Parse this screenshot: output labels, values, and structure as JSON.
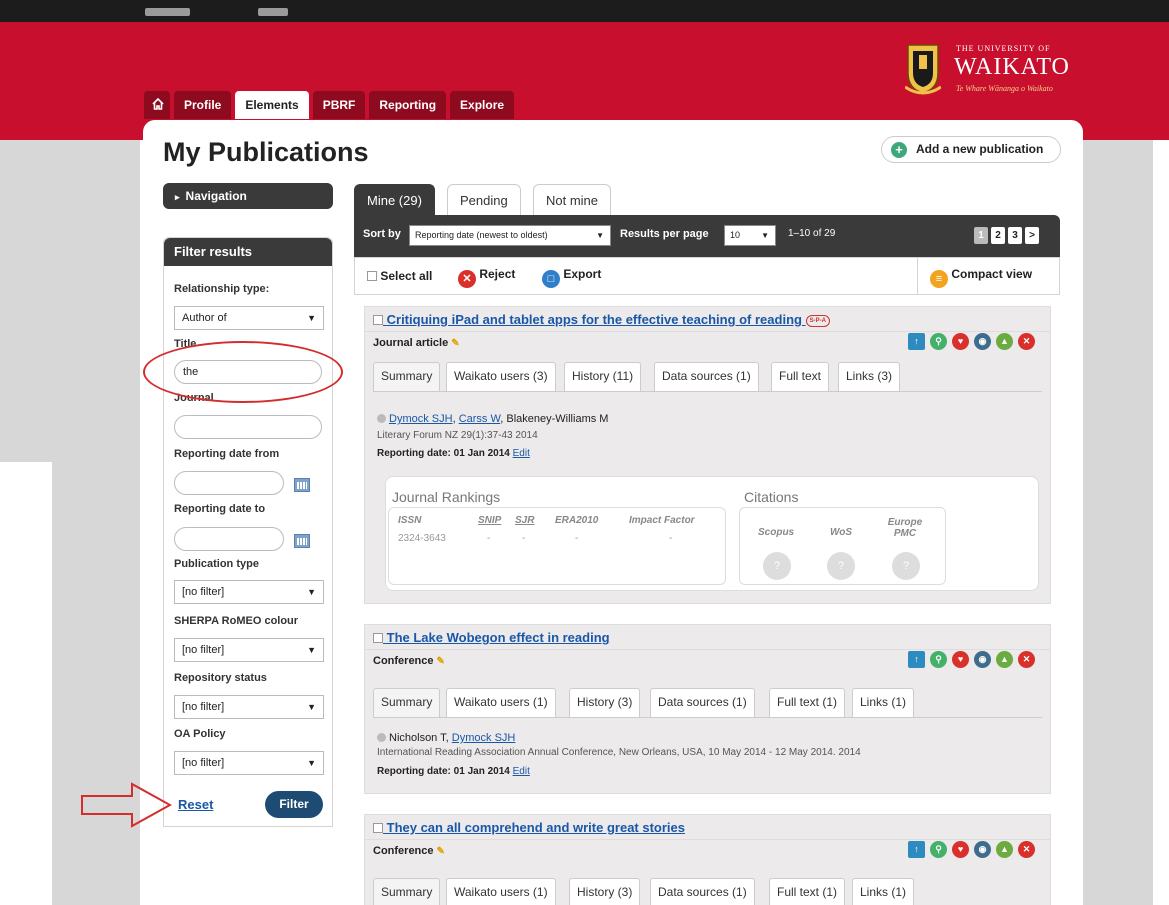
{
  "header": {
    "university_small": "THE UNIVERSITY OF",
    "university_name": "WAIKATO",
    "motto": "Te Whare Wānanga o Waikato"
  },
  "nav_tabs": [
    "Profile",
    "Elements",
    "PBRF",
    "Reporting",
    "Explore"
  ],
  "active_nav_tab": "Elements",
  "page_title": "My Publications",
  "add_button": "Add a new publication",
  "sidebar": {
    "navigation_label": "Navigation",
    "filter_title": "Filter results",
    "relationship_label": "Relationship type:",
    "relationship_value": "Author of",
    "title_label": "Title",
    "title_value": "the",
    "journal_label": "Journal",
    "journal_value": "",
    "date_from_label": "Reporting date from",
    "date_to_label": "Reporting date to",
    "pubtype_label": "Publication type",
    "pubtype_value": "[no filter]",
    "sherpa_label": "SHERPA RoMEO colour",
    "sherpa_value": "[no filter]",
    "repo_label": "Repository status",
    "repo_value": "[no filter]",
    "oa_label": "OA Policy",
    "oa_value": "[no filter]",
    "reset": "Reset",
    "filter": "Filter"
  },
  "pub_tabs": [
    "Mine (29)",
    "Pending",
    "Not mine"
  ],
  "sort_bar": {
    "sort_label": "Sort by",
    "sort_value": "Reporting date (newest to oldest)",
    "per_page_label": "Results per page",
    "per_page_value": "10",
    "range": "1–10 of 29",
    "pages": [
      "1",
      "2",
      "3",
      ">"
    ]
  },
  "actions": {
    "select_all": "Select all",
    "reject": "Reject",
    "export": "Export",
    "compact": "Compact view"
  },
  "colors": {
    "brand_red": "#c8102e",
    "dark_bar": "#3a3a3a",
    "link_blue": "#1a57a8",
    "filter_button": "#1e4b73",
    "annotation_red": "#d42d2d"
  },
  "publications": [
    {
      "title": "Critiquing iPad and tablet apps for the effective teaching of reading",
      "badge": "S-P-A",
      "type": "Journal article",
      "tabs": [
        "Summary",
        "Waikato users (3)",
        "History (11)",
        "Data sources (1)",
        "Full text",
        "Links (3)"
      ],
      "authors_linked": [
        "Dymock SJH",
        "Carss W"
      ],
      "authors_plain": "Blakeney-Williams M",
      "citation": "Literary Forum NZ 29(1):37-43 2014",
      "reporting_date": "Reporting date: 01 Jan 2014",
      "edit": "Edit",
      "metrics": {
        "journal_rankings": "Journal Rankings",
        "citations": "Citations",
        "headers": [
          "ISSN",
          "SNIP",
          "SJR",
          "ERA2010",
          "Impact Factor"
        ],
        "values": [
          "2324-3643",
          "-",
          "-",
          "-",
          "-"
        ],
        "citation_sources": [
          "Scopus",
          "WoS",
          "Europe PMC"
        ],
        "citation_counts": [
          "?",
          "?",
          "?"
        ]
      }
    },
    {
      "title": "The Lake Wobegon effect in reading",
      "type": "Conference",
      "tabs": [
        "Summary",
        "Waikato users (1)",
        "History (3)",
        "Data sources (1)",
        "Full text (1)",
        "Links (1)"
      ],
      "authors_plain": "Nicholson T",
      "authors_linked": [
        "Dymock SJH"
      ],
      "citation": "International Reading Association Annual Conference, New Orleans, USA, 10 May 2014 - 12 May 2014. 2014",
      "reporting_date": "Reporting date: 01 Jan 2014",
      "edit": "Edit"
    },
    {
      "title": "They can all comprehend and write great stories",
      "type": "Conference",
      "tabs": [
        "Summary",
        "Waikato users (1)",
        "History (3)",
        "Data sources (1)",
        "Full text (1)",
        "Links (1)"
      ]
    }
  ]
}
